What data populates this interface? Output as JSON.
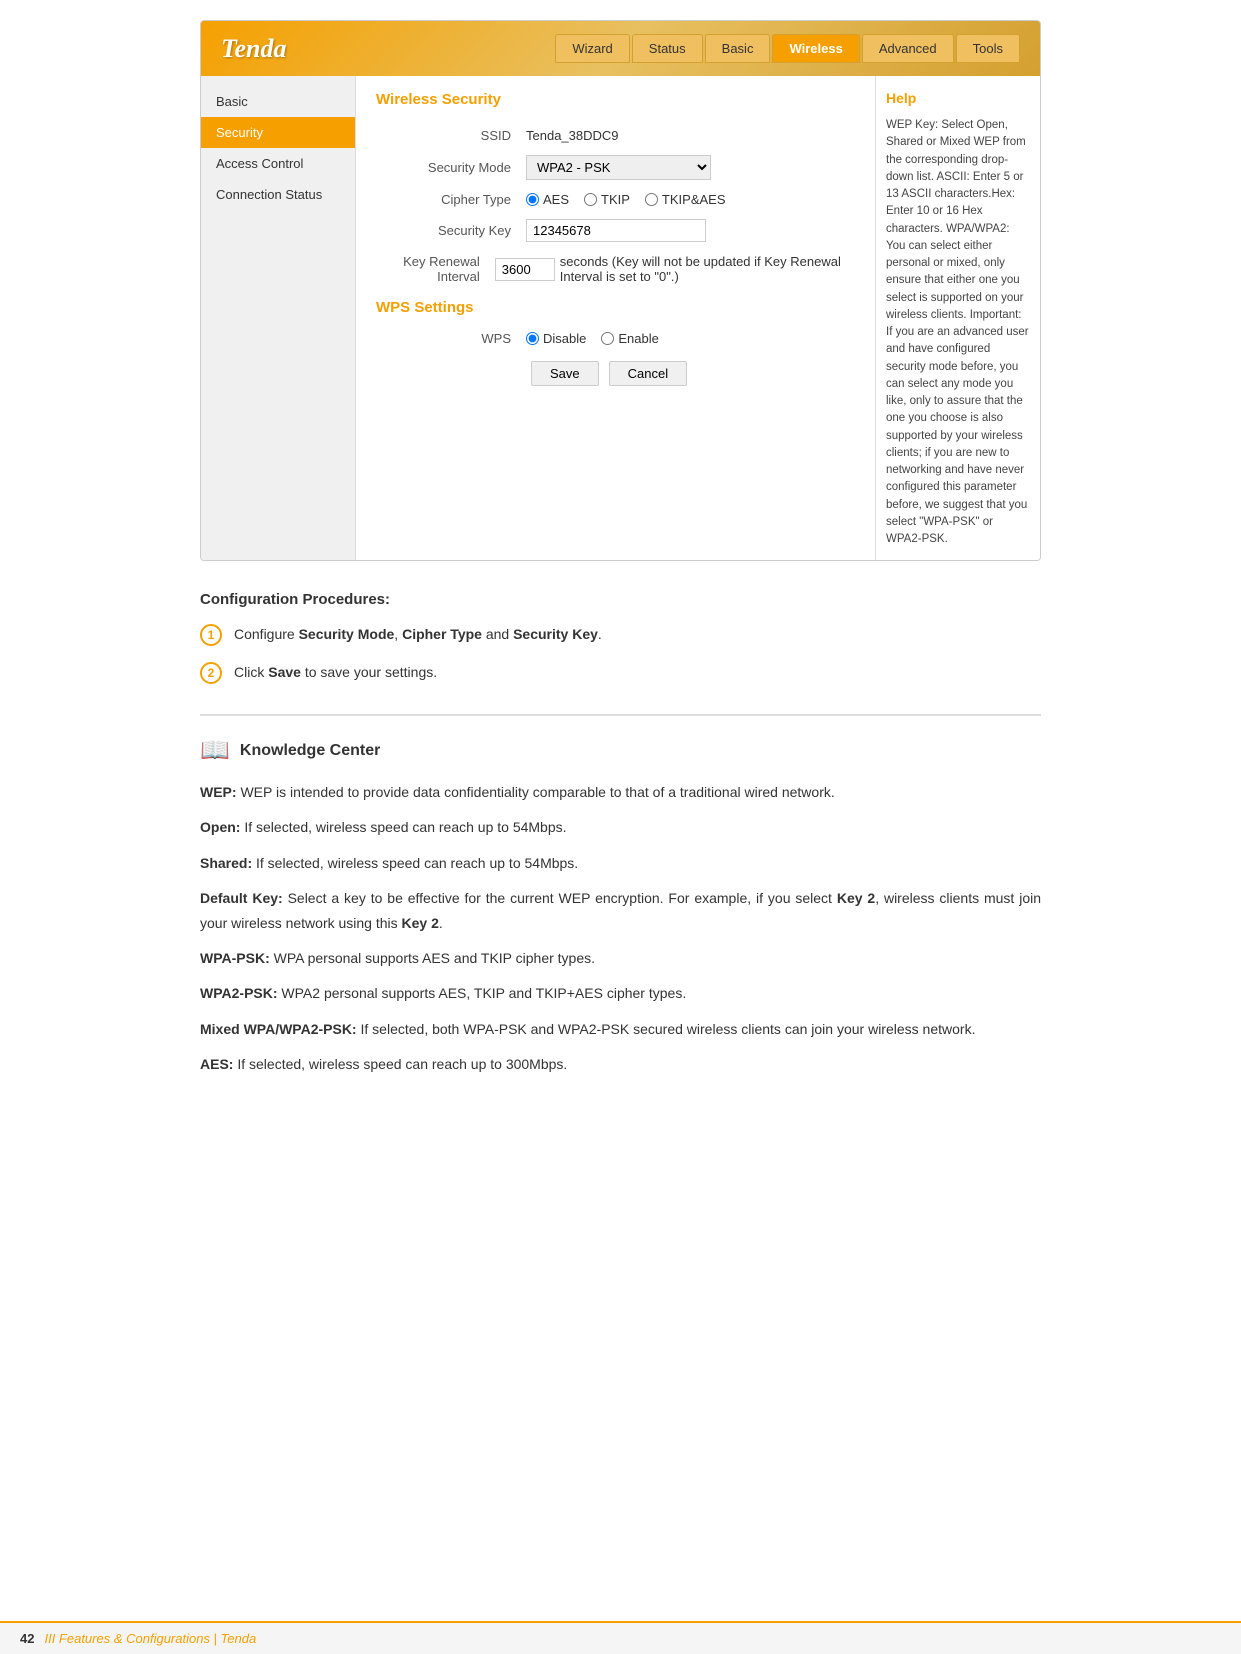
{
  "header": {
    "logo": "Tenda",
    "tabs": [
      {
        "label": "Wizard",
        "active": false
      },
      {
        "label": "Status",
        "active": false
      },
      {
        "label": "Basic",
        "active": false
      },
      {
        "label": "Wireless",
        "active": true
      },
      {
        "label": "Advanced",
        "active": false
      },
      {
        "label": "Tools",
        "active": false
      }
    ]
  },
  "sidebar": {
    "items": [
      {
        "label": "Basic",
        "active": false
      },
      {
        "label": "Security",
        "active": true
      },
      {
        "label": "Access Control",
        "active": false
      },
      {
        "label": "Connection Status",
        "active": false
      }
    ]
  },
  "main": {
    "wireless_security_title": "Wireless Security",
    "wps_settings_title": "WPS Settings",
    "ssid_label": "SSID",
    "ssid_value": "Tenda_38DDC9",
    "security_mode_label": "Security Mode",
    "security_mode_value": "WPA2 - PSK",
    "cipher_type_label": "Cipher Type",
    "cipher_aes": "AES",
    "cipher_tkip": "TKIP",
    "cipher_tkip_aes": "TKIP&AES",
    "security_key_label": "Security Key",
    "security_key_value": "12345678",
    "key_renewal_label": "Key Renewal Interval",
    "key_renewal_value": "3600",
    "key_renewal_unit": "seconds (Key will not be updated if Key Renewal Interval is set to \"0\".)",
    "wps_label": "WPS",
    "wps_disable": "Disable",
    "wps_enable": "Enable",
    "btn_save": "Save",
    "btn_cancel": "Cancel"
  },
  "help": {
    "title": "Help",
    "text": "WEP Key: Select Open, Shared or Mixed WEP from the corresponding drop-down list. ASCII: Enter 5 or 13 ASCII characters.Hex: Enter 10 or 16 Hex characters. WPA/WPA2: You can select either personal or mixed, only ensure that either one you select is supported on your wireless clients. Important: If you are an advanced user and have configured security mode before, you can select any mode you like, only to assure that the one you choose is also supported by your wireless clients; if you are new to networking and have never configured this parameter before, we suggest that you select \"WPA-PSK\" or WPA2-PSK."
  },
  "config": {
    "title": "Configuration Procedures:",
    "steps": [
      {
        "number": "1",
        "text_parts": [
          {
            "text": "Configure ",
            "bold": false
          },
          {
            "text": "Security Mode",
            "bold": true
          },
          {
            "text": ", ",
            "bold": false
          },
          {
            "text": "Cipher Type",
            "bold": true
          },
          {
            "text": " and ",
            "bold": false
          },
          {
            "text": "Security Key",
            "bold": true
          },
          {
            "text": ".",
            "bold": false
          }
        ]
      },
      {
        "number": "2",
        "text_parts": [
          {
            "text": "Click ",
            "bold": false
          },
          {
            "text": "Save",
            "bold": true
          },
          {
            "text": " to save your settings.",
            "bold": false
          }
        ]
      }
    ]
  },
  "knowledge": {
    "title": "Knowledge Center",
    "entries": [
      {
        "term": "WEP:",
        "definition": " WEP is intended to provide data confidentiality comparable to that of a traditional wired network."
      },
      {
        "term": "Open:",
        "definition": " If selected, wireless speed can reach up to 54Mbps."
      },
      {
        "term": "Shared:",
        "definition": " If selected, wireless speed can reach up to 54Mbps."
      },
      {
        "term": "Default Key:",
        "definition": " Select a key to be effective for the current WEP encryption. For example, if you select "
      },
      {
        "term": "WPA-PSK:",
        "definition": " WPA personal supports AES and TKIP cipher types."
      },
      {
        "term": "WPA2-PSK:",
        "definition": " WPA2 personal supports AES, TKIP and TKIP+AES cipher types."
      },
      {
        "term": "Mixed WPA/WPA2-PSK:",
        "definition": " If selected, both WPA-PSK and WPA2-PSK secured wireless clients can join your wireless network."
      },
      {
        "term": "AES:",
        "definition": " If selected, wireless speed can reach up to 300Mbps."
      }
    ],
    "default_key_full": "Select a key to be effective for the current WEP encryption. For example, if you select Key 2, wireless clients must join your wireless network using this Key 2."
  },
  "footer": {
    "page_number": "42",
    "text": "III Features & Configurations | Tenda"
  }
}
